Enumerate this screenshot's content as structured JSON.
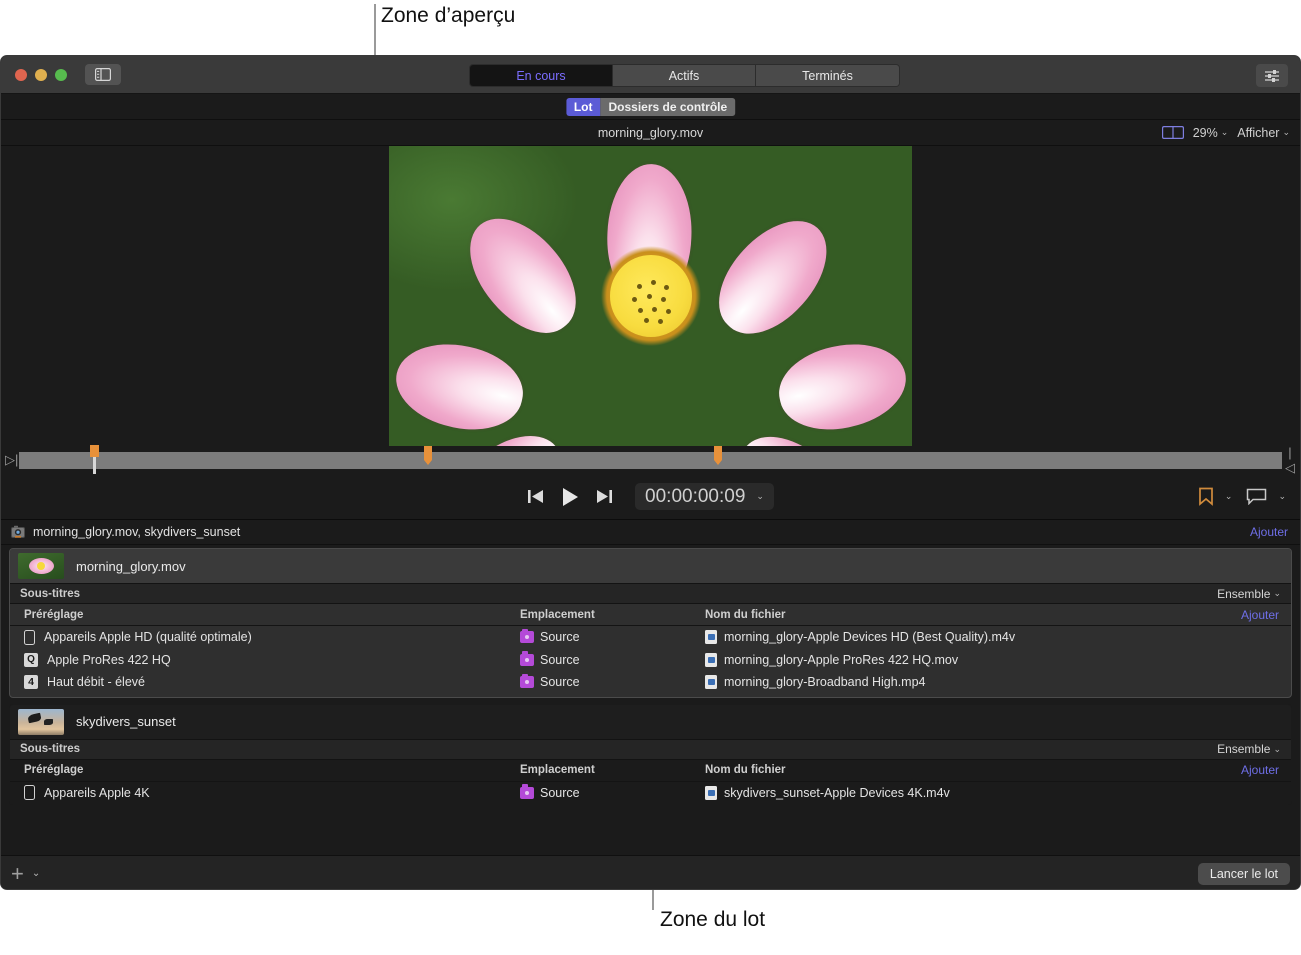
{
  "callouts": {
    "top": "Zone d’aperçu",
    "bottom": "Zone du lot"
  },
  "titlebar": {
    "sidebar_toggle_icon": "sidebar-icon",
    "settings_icon": "sliders-icon",
    "tabs": [
      {
        "label": "En cours",
        "active": true
      },
      {
        "label": "Actifs",
        "active": false
      },
      {
        "label": "Terminés",
        "active": false
      }
    ]
  },
  "subbar": {
    "pills": [
      {
        "label": "Lot",
        "selected": true
      },
      {
        "label": "Dossiers de contrôle",
        "selected": false
      }
    ]
  },
  "filebar": {
    "filename": "morning_glory.mov",
    "split_view_icon": "split-view-icon",
    "zoom": "29%",
    "view_menu": "Afficher",
    "chevron": "⌄"
  },
  "preview": {
    "alt": "Lotus flower close-up"
  },
  "transport": {
    "prev_icon": "skip-to-start-icon",
    "play_icon": "play-icon",
    "next_icon": "skip-to-end-icon",
    "timecode": "00:00:00:09",
    "timecode_chevron": "⌄",
    "marker_icon": "bookmark-icon",
    "caption_icon": "caption-bubble-icon"
  },
  "scrubber": {
    "playhead_pos_pct": 5.9,
    "markers_pct": [
      5.9,
      32.1,
      55.0
    ]
  },
  "batch": {
    "header_title": "morning_glory.mov, skydivers_sunset",
    "header_icon": "batch-camera-icon",
    "header_add": "Ajouter",
    "jobs": [
      {
        "name": "morning_glory.mov",
        "thumb": "flower-thumbnail",
        "selected": true,
        "subtitles_label": "Sous-titres",
        "subtitles_value": "Ensemble",
        "columns": [
          "Préréglage",
          "Emplacement",
          "Nom du fichier"
        ],
        "add_link": "Ajouter",
        "rows": [
          {
            "preset": "Appareils Apple HD (qualité optimale)",
            "preset_icon": "device-icon",
            "preset_badge": "",
            "location": "Source",
            "filename": "morning_glory-Apple Devices HD (Best Quality).m4v"
          },
          {
            "preset": "Apple ProRes 422 HQ",
            "preset_icon": "prores-icon",
            "preset_badge": "Q",
            "location": "Source",
            "filename": "morning_glory-Apple ProRes 422 HQ.mov"
          },
          {
            "preset": "Haut débit - élevé",
            "preset_icon": "number-badge-icon",
            "preset_badge": "4",
            "location": "Source",
            "filename": "morning_glory-Broadband High.mp4"
          }
        ]
      },
      {
        "name": "skydivers_sunset",
        "thumb": "skydivers-thumbnail",
        "selected": false,
        "subtitles_label": "Sous-titres",
        "subtitles_value": "Ensemble",
        "columns": [
          "Préréglage",
          "Emplacement",
          "Nom du fichier"
        ],
        "add_link": "Ajouter",
        "rows": [
          {
            "preset": "Appareils Apple 4K",
            "preset_icon": "device-icon",
            "preset_badge": "",
            "location": "Source",
            "filename": "skydivers_sunset-Apple Devices 4K.m4v"
          }
        ]
      }
    ]
  },
  "bottombar": {
    "add_icon": "plus-icon",
    "add_chevron": "⌄",
    "run_button": "Lancer le lot"
  },
  "colors": {
    "accent_purple": "#5b5bd6",
    "link_purple": "#6f6fe8",
    "marker_orange": "#e8913a",
    "folder_purple": "#b44ad8"
  }
}
